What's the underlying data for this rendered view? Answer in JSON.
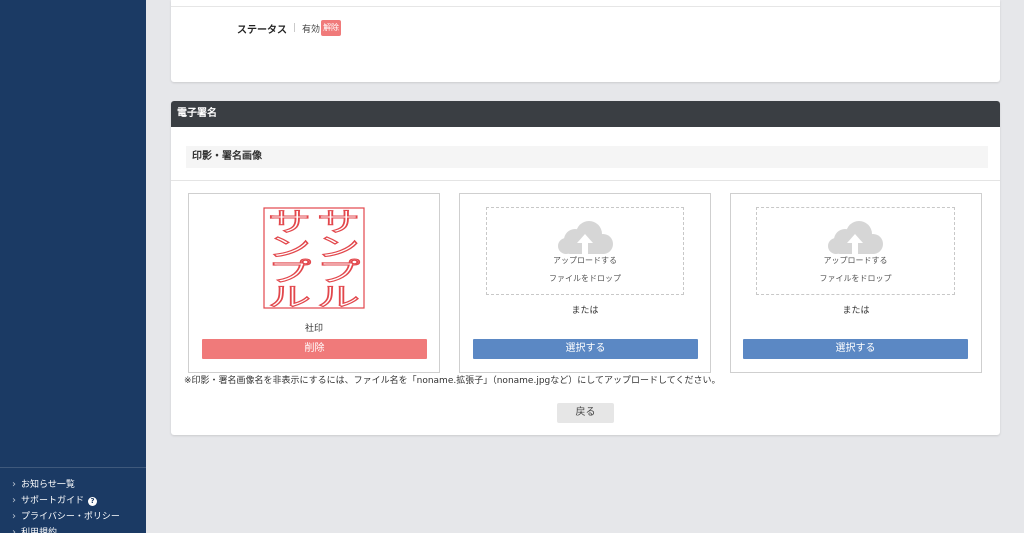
{
  "sidebar": {
    "footer_links": [
      {
        "label": "お知らせ一覧",
        "icon": "chevron-right-icon"
      },
      {
        "label": "サポートガイド",
        "icon": "chevron-right-icon",
        "trailing_icon": "question-circle-icon"
      },
      {
        "label": "プライバシー・ポリシー",
        "icon": "chevron-right-icon"
      },
      {
        "label": "利用規約",
        "icon": "chevron-right-icon"
      }
    ]
  },
  "status_card": {
    "label": "ステータス",
    "separator": "|",
    "value": "有効",
    "action_label": "解除"
  },
  "signature_card": {
    "title": "電子署名",
    "section_title": "印影・署名画像",
    "slots": [
      {
        "stamp_chars": [
          "サ",
          "ン",
          "プ",
          "ル"
        ],
        "caption": "社印",
        "button_label": "削除"
      },
      {
        "upload_icon": "cloud-upload-icon",
        "upload_text": "アップロードする",
        "drop_text": "ファイルをドロップ",
        "or_text": "または",
        "button_label": "選択する"
      },
      {
        "upload_icon": "cloud-upload-icon",
        "upload_text": "アップロードする",
        "drop_text": "ファイルをドロップ",
        "or_text": "または",
        "button_label": "選択する"
      }
    ],
    "note": "※印影・署名画像名を非表示にするには、ファイル名を「noname.拡張子」（noname.jpgなど）にしてアップロードしてください。",
    "back_label": "戻る"
  },
  "colors": {
    "page_bg": "#e6e7ea",
    "sidebar_bg": "#1b3a64",
    "card_header_bg": "#3a3e43",
    "danger": "#f07a7a",
    "primary": "#5b88c4",
    "stamp_red": "#e2474c"
  }
}
